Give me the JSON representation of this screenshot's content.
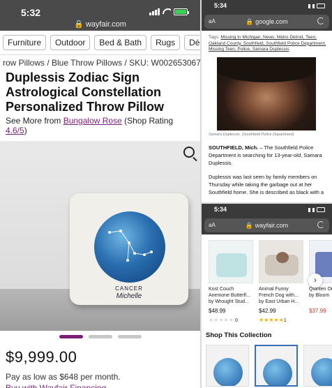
{
  "left": {
    "status": {
      "time": "5:32",
      "url": "wayfair.com"
    },
    "categories": [
      "Furniture",
      "Outdoor",
      "Bed & Bath",
      "Rugs",
      "Décor a"
    ],
    "breadcrumb": "row Pillows / Blue Throw Pillows / SKU: W002653067",
    "title": "Duplessis Zodiac Sign Astrological Constellation Personalized Throw Pillow",
    "see_more_prefix": "See More from ",
    "brand": "Bungalow Rose",
    "shop_rating_prefix": " (Shop Rating ",
    "shop_rating": "4.6/5",
    "shop_rating_suffix": ")",
    "pillow_text_1": "CANCER",
    "pillow_text_2": "Michelle",
    "price": "$9,999.00",
    "pay_line": "Pay as low as $648 per month.",
    "finance_link": "Buy with Wayfair Financing",
    "brand_color": "#7b1e7a"
  },
  "news": {
    "status": {
      "time": "5:34",
      "url": "google.com"
    },
    "tags_prefix": "Tags: ",
    "tags": "Missing In Michigan, News, Metro Detroit, Teen, Oakland County, Southfield, Southfield Police Department, Missing Teen, Police, Samara Duplessis",
    "caption": "Samara Duplessis. (Southfield Police Department)",
    "dateline": "SOUTHFIELD, Mich.",
    "para1": " – The Southfield Police Department is searching for 13-year-old, Samara Duplessis.",
    "para2": "Duplessis was last seen by family members on Thursday while taking the garbage out at her Southfield home. She is described as black with a"
  },
  "carousel": {
    "status": {
      "time": "5:34",
      "url": "wayfair.com"
    },
    "cards": [
      {
        "name": "Kost Couch Anemone Butterfl... by Wrought Stud...",
        "price": "$48.99",
        "rating_count": "0",
        "stars": 0
      },
      {
        "name": "Animal Funny French Dog with... by East Urban H...",
        "price": "$42.99",
        "rating_count": "1",
        "stars": 5
      },
      {
        "name": "Quinten Outdoor... by Bloom",
        "price": "$37.99",
        "rating_count": "",
        "stars": 0
      }
    ],
    "next_icon": "›",
    "shop_collection": "Shop This Collection"
  }
}
